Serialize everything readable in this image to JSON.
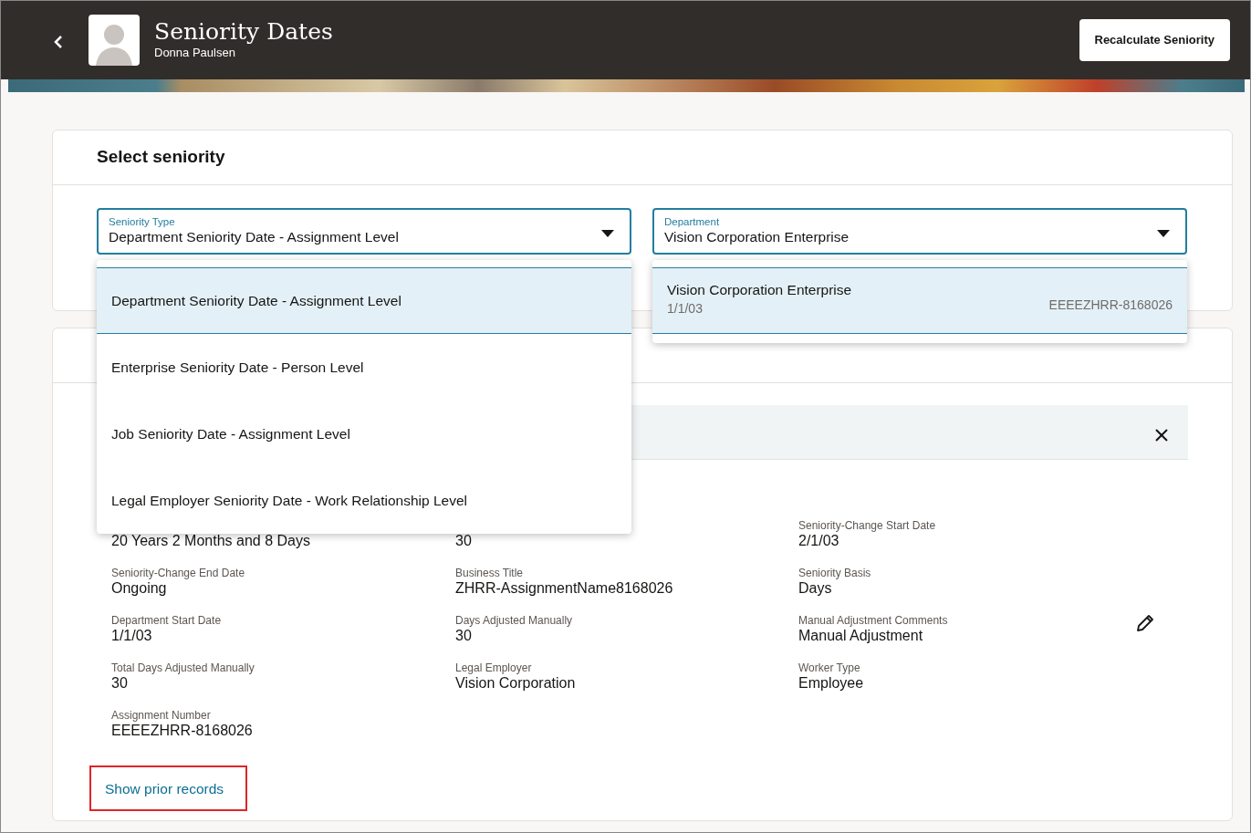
{
  "header": {
    "title": "Seniority Dates",
    "subtitle": "Donna Paulsen",
    "action": "Recalculate Seniority"
  },
  "select_card": {
    "title": "Select seniority",
    "fields": [
      {
        "label": "Seniority Type",
        "value": "Department Seniority Date - Assignment Level",
        "expanded": true,
        "options": [
          {
            "label": "Department Seniority Date - Assignment Level",
            "selected": true
          },
          {
            "label": "Enterprise Seniority Date - Person Level",
            "selected": false
          },
          {
            "label": "Job Seniority Date - Assignment Level",
            "selected": false
          },
          {
            "label": "Legal Employer Seniority Date - Work Relationship Level",
            "selected": false
          }
        ]
      },
      {
        "label": "Department",
        "value": "Vision Corporation Enterprise",
        "expanded": true,
        "options": [
          {
            "label": "Vision Corporation Enterprise",
            "detail": "1/1/03",
            "code": "EEEEZHRR-8168026",
            "selected": true
          }
        ]
      }
    ]
  },
  "details": {
    "values_under_list": [
      "20 Years 2 Months and 8 Days",
      "30"
    ],
    "fields": [
      {
        "label": "Seniority-Change Start Date",
        "value": "2/1/03"
      },
      {
        "label": "Seniority-Change End Date",
        "value": "Ongoing"
      },
      {
        "label": "Business Title",
        "value": "ZHRR-AssignmentName8168026"
      },
      {
        "label": "Seniority Basis",
        "value": "Days"
      },
      {
        "label": "Department Start Date",
        "value": "1/1/03"
      },
      {
        "label": "Days Adjusted Manually",
        "value": "30"
      },
      {
        "label": "Manual Adjustment Comments",
        "value": "Manual Adjustment"
      },
      {
        "label": "Total Days Adjusted Manually",
        "value": "30"
      },
      {
        "label": "Legal Employer",
        "value": "Vision Corporation"
      },
      {
        "label": "Worker Type",
        "value": "Employee"
      },
      {
        "label": "Assignment Number",
        "value": "EEEEZHRR-8168026"
      }
    ],
    "link": "Show prior records"
  }
}
